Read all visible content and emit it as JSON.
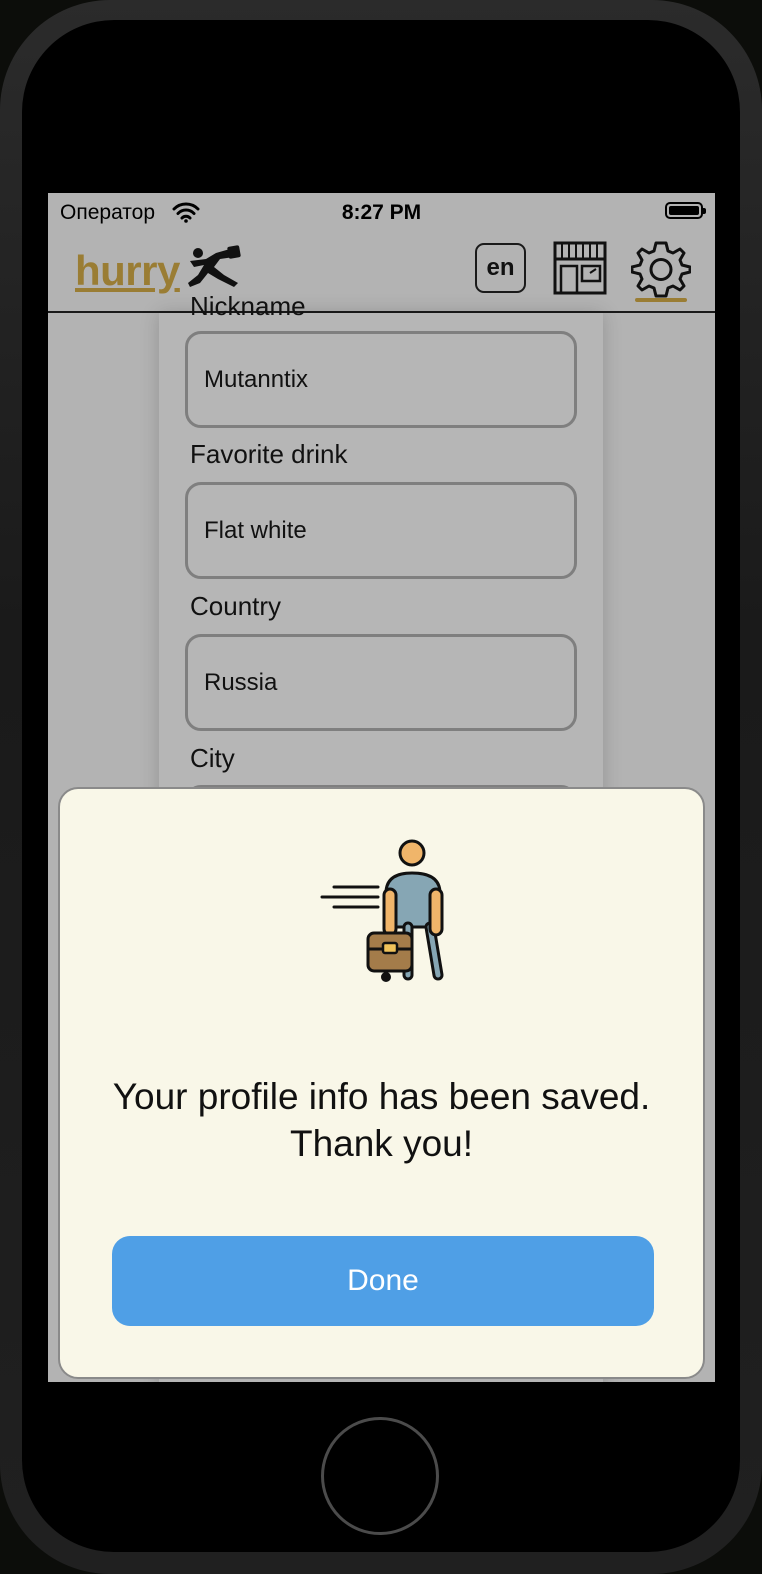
{
  "status_bar": {
    "carrier": "Оператор",
    "time": "8:27 PM"
  },
  "navbar": {
    "logo": "hurry",
    "language": "en",
    "active_tab": "settings",
    "accent_color": "#9a7d34"
  },
  "form": {
    "fields": [
      {
        "label": "Nickname",
        "value": "Mutanntix"
      },
      {
        "label": "Favorite drink",
        "value": "Flat white"
      },
      {
        "label": "Country",
        "value": "Russia"
      },
      {
        "label": "City",
        "value": ""
      }
    ]
  },
  "dialog": {
    "message_line1": "Your profile info has been saved.",
    "message_line2": "Thank you!",
    "done_label": "Done",
    "button_color": "#4f9fe6"
  },
  "icons": [
    "wifi-icon",
    "battery-icon",
    "runner-logo-icon",
    "shop-icon",
    "gear-icon",
    "hurrying-person-illustration"
  ]
}
